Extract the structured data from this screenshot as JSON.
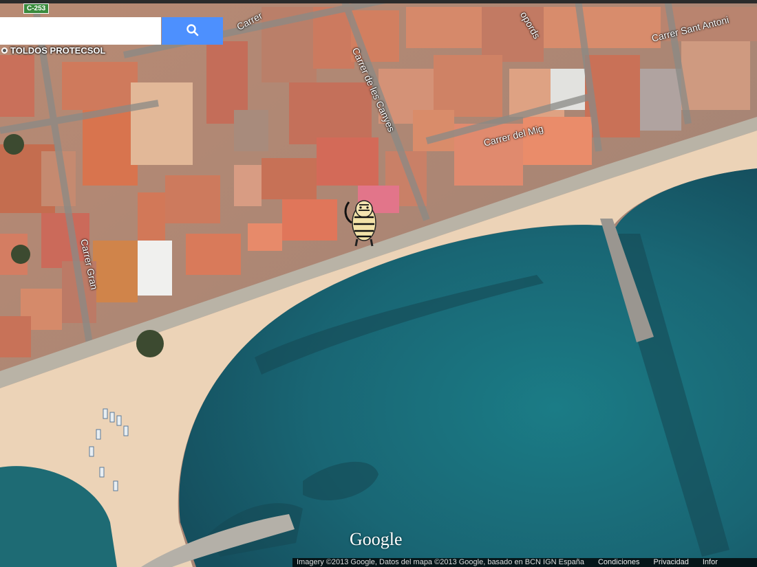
{
  "search": {
    "placeholder": "",
    "button_icon": "search-icon"
  },
  "place": {
    "label": "TOLDOS PROTECSOL",
    "icon": "place-marker-icon"
  },
  "road": {
    "badge": "C-253"
  },
  "streets": {
    "carrer_1": "Carrer",
    "carrer_de_les_canyes": "Carrer de les Canyes",
    "carrer_del_mig": "Carrer del Mig",
    "carrer_sant_antoni": "Carrer Sant Antoni",
    "fragment_top": "opords",
    "carrer_gran": "Carrer Gran"
  },
  "pegman": {
    "icon": "tiger-pegman-icon"
  },
  "branding": {
    "logo": "Google"
  },
  "footer": {
    "imagery": "Imagery ©2013 Google, Datos del mapa ©2013 Google, basado en BCN IGN España",
    "terms": "Condiciones",
    "privacy": "Privacidad",
    "info": "Infor"
  },
  "colors": {
    "search_button": "#4d90fe",
    "sea": "#1f6f7a",
    "sand": "#f0d5b8",
    "roofs": "#c86a4f"
  }
}
